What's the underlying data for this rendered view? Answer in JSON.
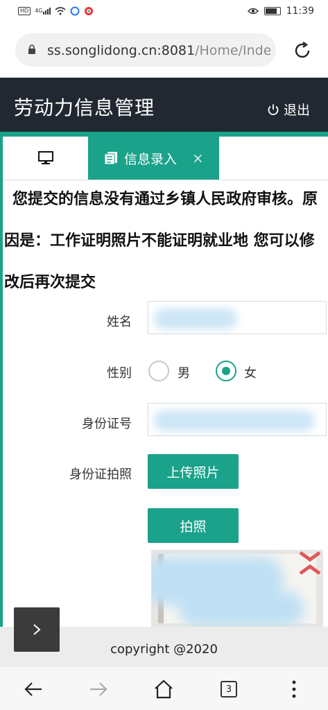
{
  "status_bar": {
    "hd": "HD",
    "signal": "4G",
    "time": "11:39"
  },
  "browser": {
    "url_host": "ss.songlidong.cn:8081",
    "url_path": "/Home/Inde"
  },
  "app": {
    "title": "劳动力信息管理",
    "logout_label": "退出"
  },
  "tabs": {
    "active_label": "信息录入",
    "close": "×"
  },
  "message": "您提交的信息没有通过乡镇人民政府审核。原因是：工作证明照片不能证明就业地 您可以修改后再次提交",
  "form": {
    "name_label": "姓名",
    "gender_label": "性别",
    "gender_options": [
      "男",
      "女"
    ],
    "gender_selected": "女",
    "id_label": "身份证号",
    "id_photo_label": "身份证拍照",
    "upload_button": "上传照片",
    "photo_button": "拍照"
  },
  "footer": {
    "copyright": "copyright @2020"
  },
  "bottom_nav": {
    "tab_count": "3"
  },
  "colors": {
    "accent": "#1aa28a",
    "header_bg": "#222831"
  }
}
